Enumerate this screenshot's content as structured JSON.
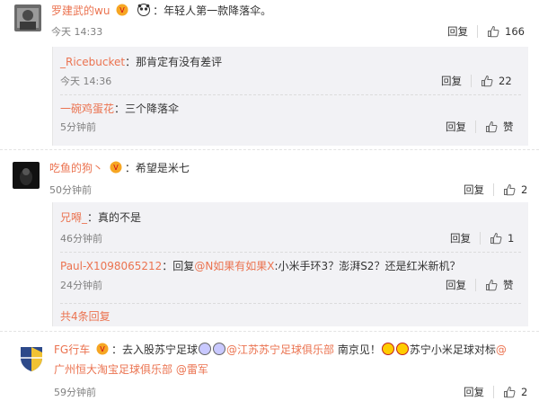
{
  "actions": {
    "reply": "回复",
    "like": "赞"
  },
  "comment1": {
    "user": "罗建武的wu",
    "text": "：年轻人第一款降落伞。",
    "time": "今天 14:33",
    "likes": "166",
    "replies": [
      {
        "user": "_Ricebucket",
        "text": "：那肯定有没有差评",
        "time": "今天 14:36",
        "likes": "22"
      },
      {
        "user": "一碗鸡蛋花",
        "text": "：三个降落伞",
        "time": "5分钟前",
        "likes": "赞"
      }
    ]
  },
  "comment2": {
    "user": "吃鱼的狗丶",
    "text": "：希望是米七",
    "time": "50分钟前",
    "likes": "2",
    "replies": [
      {
        "user": "兄嘚_",
        "text": "：真的不是",
        "time": "46分钟前",
        "likes": "1"
      },
      {
        "user": "Paul-X1098065212",
        "text_pre": "：回复",
        "mention": "@N如果有如果X",
        "text_post": ":小米手环3？澎湃S2？还是红米新机？",
        "time": "24分钟前",
        "likes": "赞"
      }
    ],
    "more": "共4条回复"
  },
  "comment3": {
    "user": "FG行车",
    "text_a": "：去入股苏宁足球",
    "mention_a": "@江苏苏宁足球俱乐部",
    "text_b": " 南京见！",
    "text_c": "苏宁小米足球对标",
    "mention_b": "@",
    "line2_link": "广州恒大淘宝足球俱乐部",
    "mention_c": "@雷军",
    "time": "59分钟前",
    "likes": "2"
  },
  "colors": {
    "link": "#eb7350",
    "meta": "#808080",
    "subbox": "#f2f2f5"
  }
}
